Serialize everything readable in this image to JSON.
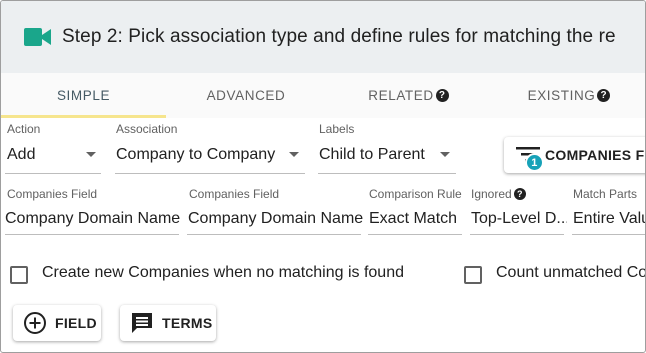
{
  "header": {
    "title": "Step 2: Pick association type and define rules for matching the re",
    "icon": "video-camera-icon",
    "accent_color": "#1aa68b"
  },
  "tabs": [
    {
      "label": "SIMPLE",
      "active": true
    },
    {
      "label": "ADVANCED",
      "active": false
    },
    {
      "label": "RELATED",
      "active": false,
      "help": "?"
    },
    {
      "label": "EXISTING",
      "active": false,
      "help": "?"
    }
  ],
  "row1": {
    "action": {
      "label": "Action",
      "value": "Add"
    },
    "association": {
      "label": "Association",
      "value": "Company to Company"
    },
    "labels": {
      "label": "Labels",
      "value": "Child to Parent"
    },
    "companies_filter_button": {
      "label": "COMPANIES FIL",
      "badge": "1"
    }
  },
  "rule": {
    "headers": {
      "source_field": "Companies Field",
      "target_field": "Companies Field",
      "comparison": "Comparison Rule",
      "ignored": "Ignored",
      "ignored_help": "?",
      "match_parts": "Match Parts"
    },
    "values": {
      "source_field": "Company Domain Name",
      "target_field": "Company Domain Name",
      "comparison": "Exact Match",
      "ignored": "Top-Level D...",
      "match_parts": "Entire Valu"
    }
  },
  "options": {
    "create_new": {
      "label": "Create new Companies when no matching is found",
      "checked": false
    },
    "count_unmatched": {
      "label": "Count unmatched Co",
      "checked": false
    }
  },
  "buttons": {
    "field": "FIELD",
    "terms": "TERMS"
  }
}
